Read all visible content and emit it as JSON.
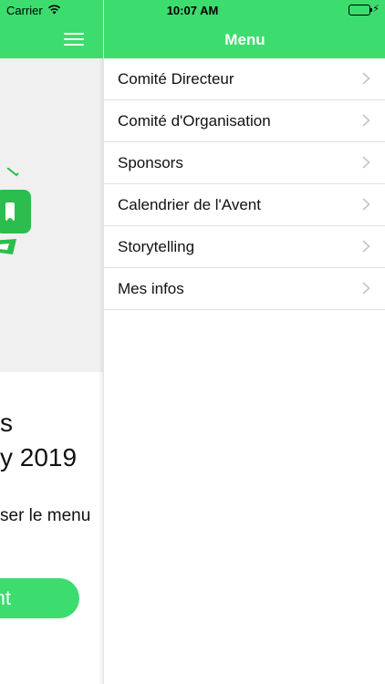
{
  "status_bar": {
    "carrier": "Carrier",
    "time": "10:07 AM"
  },
  "left_screen": {
    "title_line1": "s",
    "title_line2": "y 2019",
    "hint": "ser le menu",
    "button_label": "nt",
    "accent_color": "#3ddc6e"
  },
  "menu": {
    "title": "Menu",
    "items": [
      {
        "label": "Comité Directeur"
      },
      {
        "label": "Comité d'Organisation"
      },
      {
        "label": "Sponsors"
      },
      {
        "label": "Calendrier de l'Avent"
      },
      {
        "label": "Storytelling"
      },
      {
        "label": "Mes infos"
      }
    ]
  },
  "icons": {
    "hamburger": "hamburger-icon",
    "chevron": "chevron-right-icon",
    "wifi": "wifi-icon",
    "battery": "battery-icon"
  }
}
